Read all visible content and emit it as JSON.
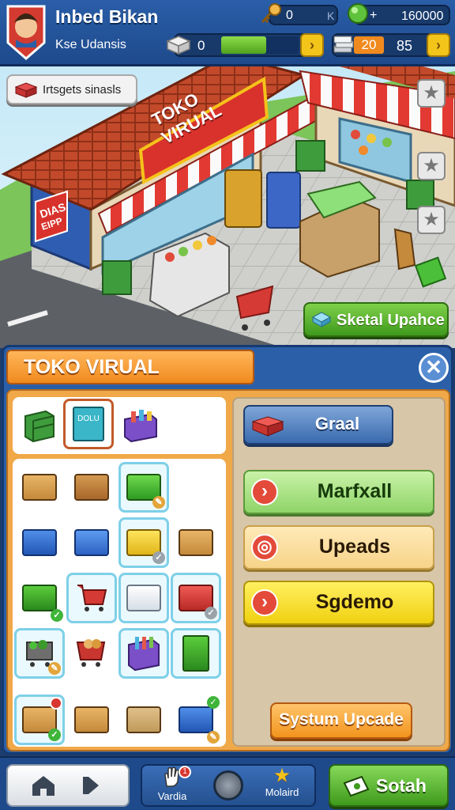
{
  "header": {
    "player_name": "Inbed Bikan",
    "player_subtitle": "Kse Udansis",
    "key_count": "0",
    "key_tag": "K",
    "gem_plus": "+",
    "gem_count": "160000",
    "box_count": "0",
    "progress_fraction": 0.58,
    "stack_value_a": "20",
    "stack_value_b": "85",
    "arrow_glyph": "›"
  },
  "scene": {
    "shop_button_label": "Irtsgets sinasls",
    "store_sign": "TOKO VIRUAL",
    "side_sign_line1": "DIAS",
    "side_sign_line2": "EIPP",
    "special_upgrade_label": "Sketal Upahce",
    "star_glyph": "★"
  },
  "panel": {
    "title": "TOKO VIRUAL",
    "close_glyph": "✕",
    "tab_book_text": "DOLU"
  },
  "actions": {
    "graal_label": "Graal",
    "marfxall_label": "Marfxall",
    "upeads_label": "Upeads",
    "sgdemo_label": "Sgdemo",
    "system_upgrade_label": "Systum Upcade",
    "circle_arrow": "›",
    "circle_target": "◎"
  },
  "nav": {
    "home_icon_label": "",
    "play_icon_label": "",
    "varia_label": "Vardia",
    "badge_count": "1",
    "moaird_label": "Molaird",
    "sotah_label": "Sotah"
  },
  "colors": {
    "accent_orange": "#f08a1e",
    "accent_blue": "#2b5fa8",
    "accent_green": "#3f9a1c",
    "accent_yellow": "#f3d21c"
  }
}
